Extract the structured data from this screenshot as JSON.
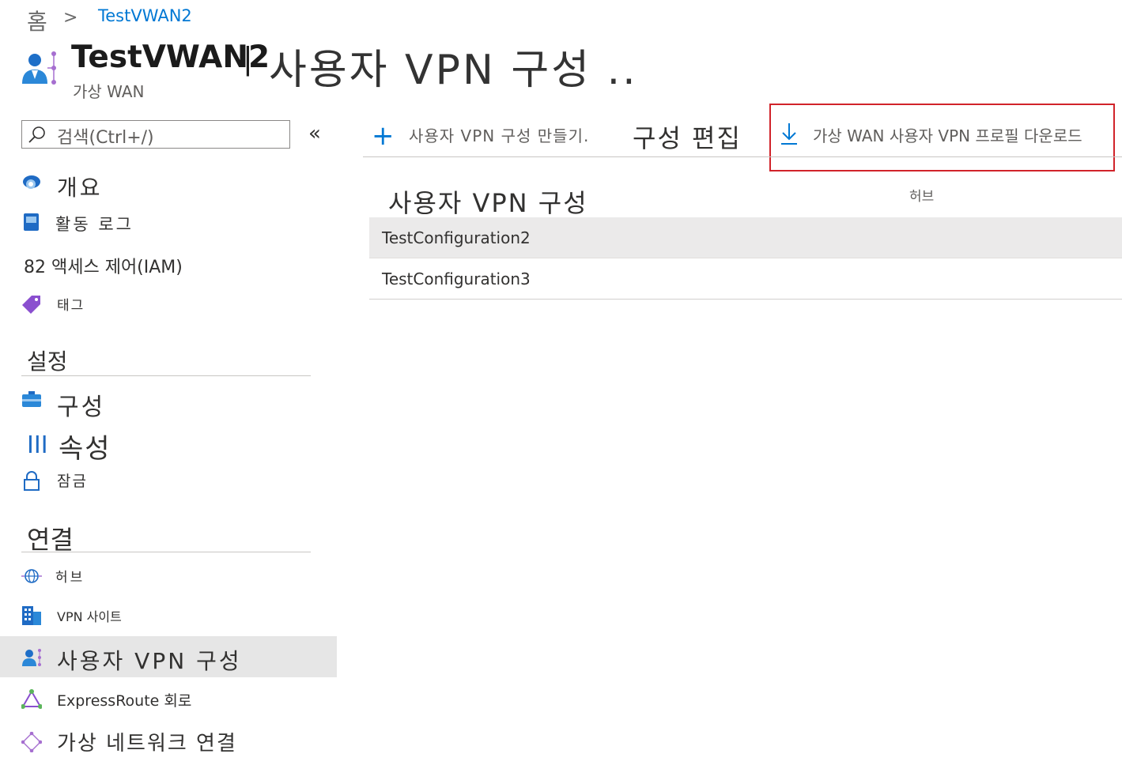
{
  "breadcrumb": {
    "home": "홈",
    "separator": ">",
    "current": "TestVWAN2"
  },
  "header": {
    "resource_name": "TestVWAN2",
    "separator": "|",
    "page_title": "사용자 VPN 구성 ..",
    "resource_type": "가상 WAN"
  },
  "sidebar": {
    "search_placeholder": "검색(Ctrl+/)",
    "collapse_label": "«",
    "top_items": [
      {
        "label": "개요",
        "icon": "overview-cloud-icon"
      },
      {
        "label": "활동 로그",
        "icon": "activity-log-icon"
      },
      {
        "label": "82 액세스 제어(IAM)",
        "icon": ""
      },
      {
        "label": "태그",
        "icon": "tag-icon"
      }
    ],
    "sections": [
      {
        "title": "설정",
        "items": [
          {
            "label": "구성",
            "icon": "configuration-icon"
          },
          {
            "label": "속성",
            "icon": "properties-icon",
            "icon_text": "III"
          },
          {
            "label": "잠금",
            "icon": "lock-icon"
          }
        ]
      },
      {
        "title": "연결",
        "items": [
          {
            "label": "허브",
            "icon": "hub-globe-icon"
          },
          {
            "label": "VPN 사이트",
            "icon": "vpn-site-building-icon"
          },
          {
            "label": "사용자 VPN 구성",
            "icon": "user-vpn-icon",
            "selected": true
          },
          {
            "label": "ExpressRoute 회로",
            "icon": "expressroute-icon"
          },
          {
            "label": "가상 네트워크 연결",
            "icon": "vnet-connection-icon"
          }
        ]
      }
    ]
  },
  "toolbar": {
    "create_label": "사용자 VPN 구성 만들기.",
    "edit_label": "구성 편집",
    "download_label": "가상 WAN 사용자 VPN 프로필 다운로드"
  },
  "table": {
    "columns": [
      "사용자 VPN 구성",
      "허브"
    ],
    "rows": [
      {
        "name": "TestConfiguration2",
        "hub": ""
      },
      {
        "name": "TestConfiguration3",
        "hub": ""
      }
    ]
  },
  "colors": {
    "accent": "#0078d4",
    "highlight_border": "#d1232a",
    "selected_bg": "#e6e6e6"
  }
}
